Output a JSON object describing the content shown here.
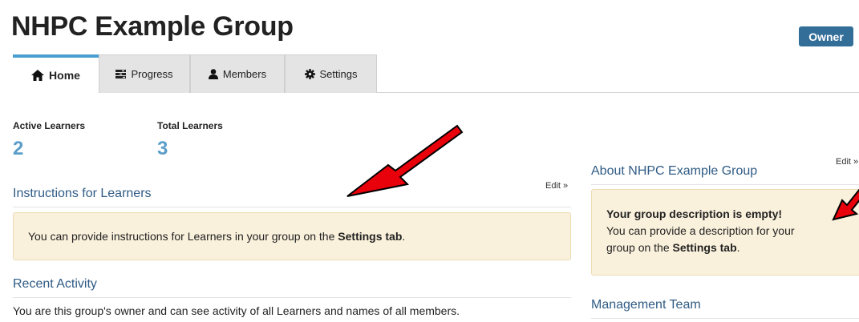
{
  "group": {
    "title": "NHPC Example Group",
    "role_badge": "Owner"
  },
  "tabs": [
    {
      "label": "Home",
      "icon": "home-icon"
    },
    {
      "label": "Progress",
      "icon": "progress-icon"
    },
    {
      "label": "Members",
      "icon": "person-icon"
    },
    {
      "label": "Settings",
      "icon": "gear-icon"
    }
  ],
  "stats": {
    "active_label": "Active Learners",
    "active_value": "2",
    "total_label": "Total Learners",
    "total_value": "3"
  },
  "instructions": {
    "heading": "Instructions for Learners",
    "edit_label": "Edit »",
    "text_before": "You can provide instructions for Learners in your group on the ",
    "text_bold": "Settings tab",
    "text_after": "."
  },
  "recent_activity": {
    "heading": "Recent Activity",
    "text": "You are this group's owner and can see activity of all Learners and names of all members."
  },
  "about": {
    "heading": "About NHPC Example Group",
    "edit_label": "Edit »",
    "empty_title": "Your group description is empty!",
    "text_line1": "You can provide a description for your",
    "text_before": "group on the ",
    "text_bold": "Settings tab",
    "text_after": "."
  },
  "management": {
    "heading": "Management Team"
  },
  "colors": {
    "accent": "#4a9fd1",
    "badge": "#336e99",
    "notice_bg": "#faf1dc",
    "heading": "#2f5b85",
    "annotation_arrow": "#e8000b"
  }
}
